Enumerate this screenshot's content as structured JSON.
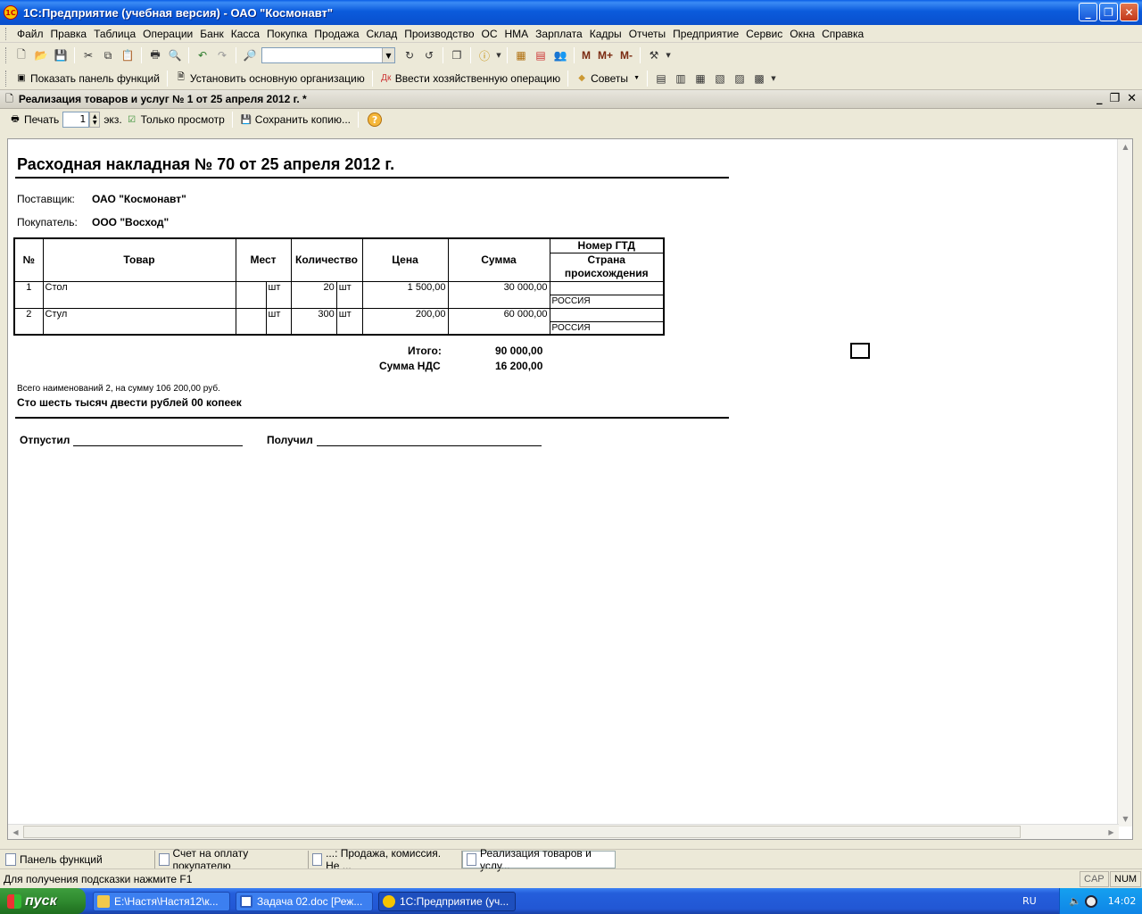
{
  "app": {
    "title": "1С:Предприятие (учебная версия) - ОАО \"Космонавт\""
  },
  "menu": [
    "Файл",
    "Правка",
    "Таблица",
    "Операции",
    "Банк",
    "Касса",
    "Покупка",
    "Продажа",
    "Склад",
    "Производство",
    "ОС",
    "НМА",
    "Зарплата",
    "Кадры",
    "Отчеты",
    "Предприятие",
    "Сервис",
    "Окна",
    "Справка"
  ],
  "toolbar2": {
    "show_panel": "Показать панель функций",
    "set_org": "Установить основную организацию",
    "enter_op": "Ввести хозяйственную операцию",
    "tips": "Советы"
  },
  "toolbar1": {
    "m": "M",
    "mplus": "M+",
    "mminus": "M-",
    "search_value": ""
  },
  "document": {
    "window_title": "Реализация товаров и услуг № 1 от 25 апреля 2012 г. *",
    "print_label": "Печать",
    "copies": "1",
    "copies_unit": "экз.",
    "readonly_label": "Только просмотр",
    "save_copy_label": "Сохранить копию...",
    "heading": "Расходная накладная № 70 от 25 апреля 2012 г.",
    "supplier_label": "Поставщик:",
    "supplier": "ОАО \"Космонавт\"",
    "buyer_label": "Покупатель:",
    "buyer": "ООО \"Восход\"",
    "table": {
      "headers": {
        "num": "№",
        "item": "Товар",
        "places": "Мест",
        "qty": "Количество",
        "price": "Цена",
        "sum": "Сумма",
        "gtd": "Номер ГТД",
        "country": "Страна происхождения"
      },
      "rows": [
        {
          "num": "1",
          "item": "Стол",
          "places_unit": "шт",
          "qty": "20",
          "qty_unit": "шт",
          "price": "1 500,00",
          "sum": "30 000,00",
          "gtd": "",
          "country": "РОССИЯ"
        },
        {
          "num": "2",
          "item": "Стул",
          "places_unit": "шт",
          "qty": "300",
          "qty_unit": "шт",
          "price": "200,00",
          "sum": "60 000,00",
          "gtd": "",
          "country": "РОССИЯ"
        }
      ]
    },
    "total_label": "Итого:",
    "total": "90 000,00",
    "vat_label": "Сумма НДС",
    "vat": "16 200,00",
    "summary": "Всего наименований 2, на сумму 106 200,00 руб.",
    "amount_words": "Сто шесть тысяч двести рублей 00 копеек",
    "released_label": "Отпустил",
    "received_label": "Получил"
  },
  "window_tabs": [
    "Панель функций",
    "Счет на оплату покупателю",
    "...: Продажа, комиссия. Не ...",
    "Реализация товаров и услу..."
  ],
  "status": {
    "hint": "Для получения подсказки нажмите F1",
    "cap": "CAP",
    "num": "NUM"
  },
  "taskbar": {
    "start": "пуск",
    "tasks": [
      "E:\\Настя\\Настя12\\к...",
      "Задача 02.doc [Реж...",
      "1С:Предприятие (уч..."
    ],
    "lang": "RU",
    "clock": "14:02"
  }
}
